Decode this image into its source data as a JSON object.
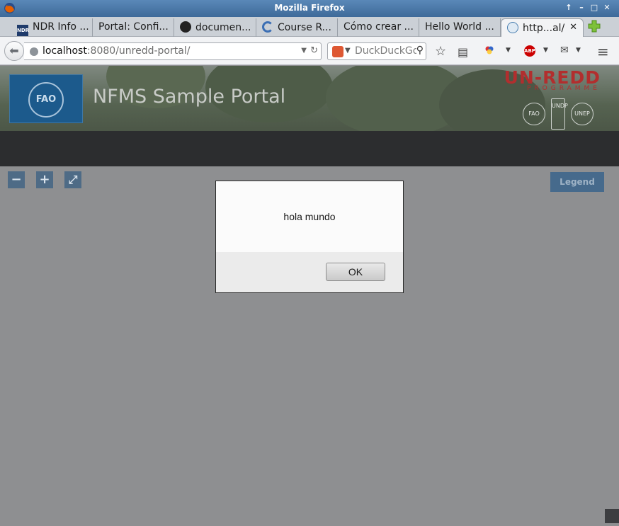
{
  "window": {
    "title": "Mozilla Firefox",
    "controls": [
      "↑",
      "–",
      "□",
      "✕"
    ]
  },
  "tabs": [
    {
      "label": "NDR Info ...",
      "icon": "ndr-icon"
    },
    {
      "label": "Portal: Confi...",
      "icon": "none"
    },
    {
      "label": "documen...",
      "icon": "github-icon"
    },
    {
      "label": "Course R...",
      "icon": "course-icon"
    },
    {
      "label": "Cómo crear ...",
      "icon": "none"
    },
    {
      "label": "Hello World ...",
      "icon": "none"
    },
    {
      "label": "http...al/",
      "icon": "globe-icon",
      "active": true,
      "close": "✕"
    }
  ],
  "nav": {
    "url_host": "localhost",
    "url_rest": ":8080/unredd-portal/",
    "search_placeholder": "DuckDuckGo"
  },
  "page": {
    "title": "NFMS Sample Portal",
    "logo_text": "FAO",
    "unredd_title": "UN-REDD",
    "unredd_sub": "PROGRAMME",
    "agencies": [
      "FAO",
      "UNDP",
      "UNEP"
    ],
    "legend_label": "Legend",
    "map_controls": [
      "−",
      "+",
      "⤢"
    ]
  },
  "dialog": {
    "message": "hola mundo",
    "ok_label": "OK"
  }
}
